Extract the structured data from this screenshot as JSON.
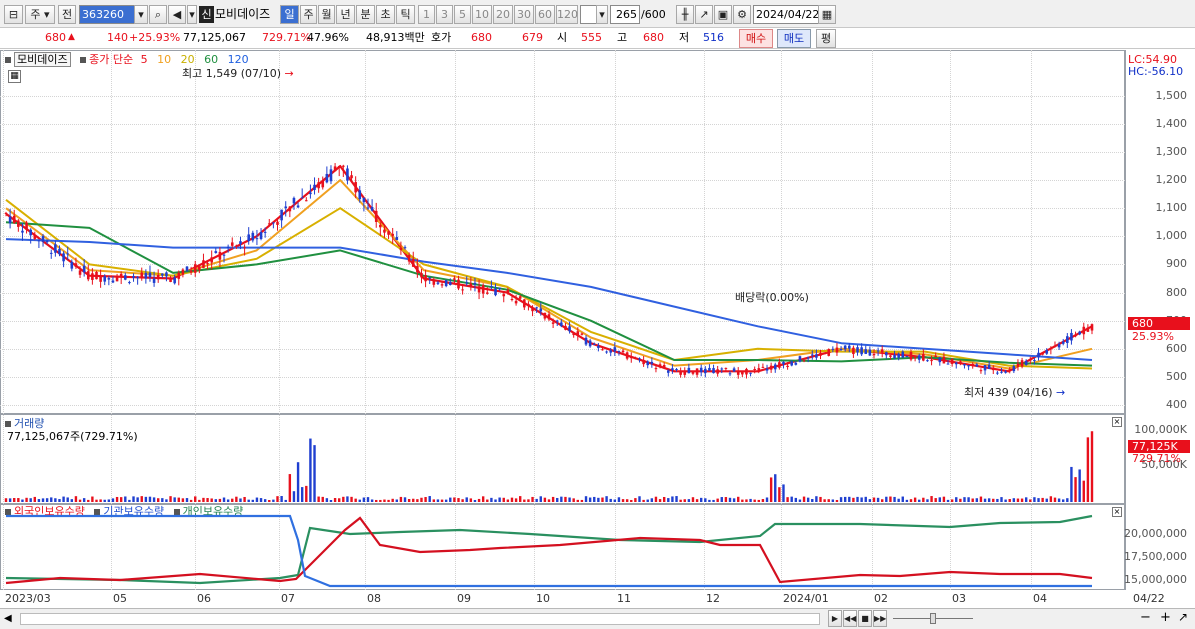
{
  "toolbar": {
    "market_select": "주",
    "prev_label": "전",
    "code_value": "363260",
    "type_badge": "신",
    "stock_name": "모비데이즈",
    "period_tabs": [
      "일",
      "주",
      "월",
      "년",
      "분",
      "초",
      "틱"
    ],
    "interval_tabs": [
      "1",
      "3",
      "5",
      "10",
      "20",
      "30",
      "60",
      "120"
    ],
    "count_value": "265",
    "count_max": "/600",
    "date_value": "2024/04/22"
  },
  "info": {
    "price": "680",
    "change": "140",
    "change_pct": "+25.93%",
    "volume": "77,125,067",
    "volume_ratio": "729.71%",
    "turnover": "47.96%",
    "amount": "48,913백만",
    "quote_label": "호가",
    "ask": "680",
    "bid": "679",
    "open_label": "시",
    "open": "555",
    "high_label": "고",
    "high": "680",
    "low_label": "저",
    "low": "516",
    "buy_button": "매수",
    "sell_button": "매도",
    "eval_button": "평"
  },
  "price_panel": {
    "title": "모비데이즈",
    "ma_title": "종가 단순",
    "ma_periods": [
      "5",
      "10",
      "20",
      "60",
      "120"
    ],
    "high_annotation": "최고 1,549 (07/10)",
    "low_annotation": "최저 439 (04/16)",
    "dividend_annotation": "배당락(0.00%)",
    "lc_label": "LC:54.90",
    "hc_label": "HC:-56.10",
    "y_ticks": [
      "1,500",
      "1,400",
      "1,300",
      "1,200",
      "1,100",
      "1,000",
      "900",
      "800",
      "700",
      "600",
      "500",
      "400"
    ],
    "last_price_tag": "680",
    "last_pct_tag": "25.93%"
  },
  "volume_panel": {
    "title": "거래량",
    "value_label": "77,125,067주(729.71%)",
    "y_ticks": [
      "100,000K",
      "50,000K"
    ],
    "last_tag": "77,125K",
    "last_pct_tag": "729.71%"
  },
  "holding_panel": {
    "legend": [
      "외국인보유수량",
      "기관보유수량",
      "개인보유수량"
    ],
    "y_ticks": [
      "20,000,000",
      "17,500,000",
      "15,000,000"
    ]
  },
  "x_axis": {
    "labels": [
      "2023/03",
      "05",
      "06",
      "07",
      "08",
      "09",
      "10",
      "11",
      "12",
      "2024/01",
      "02",
      "03",
      "04"
    ],
    "end_label": "04/22"
  },
  "chart_data": {
    "type": "line",
    "title": "모비데이즈",
    "x": [
      "2023/03",
      "05",
      "06",
      "07",
      "08",
      "09",
      "10",
      "11",
      "12",
      "2024/01",
      "02",
      "03",
      "04",
      "04/22"
    ],
    "series": [
      {
        "name": "5",
        "values": [
          1080,
          860,
          850,
          1000,
          1250,
          850,
          800,
          620,
          520,
          520,
          600,
          570,
          520,
          680
        ]
      },
      {
        "name": "10",
        "values": [
          1100,
          880,
          860,
          950,
          1200,
          880,
          820,
          640,
          540,
          560,
          600,
          580,
          530,
          600
        ]
      },
      {
        "name": "20",
        "values": [
          1130,
          900,
          860,
          920,
          1100,
          900,
          820,
          660,
          560,
          600,
          590,
          590,
          540,
          530
        ]
      },
      {
        "name": "60",
        "values": [
          1050,
          1030,
          870,
          900,
          950,
          860,
          810,
          700,
          560,
          560,
          555,
          570,
          550,
          540
        ]
      },
      {
        "name": "120",
        "values": [
          990,
          980,
          960,
          960,
          960,
          910,
          870,
          820,
          750,
          680,
          620,
          600,
          580,
          560
        ]
      }
    ],
    "ylim": [
      400,
      1549
    ],
    "annotations": [
      "최고 1,549 (07/10)",
      "최저 439 (04/16)",
      "배당락(0.00%)"
    ]
  }
}
